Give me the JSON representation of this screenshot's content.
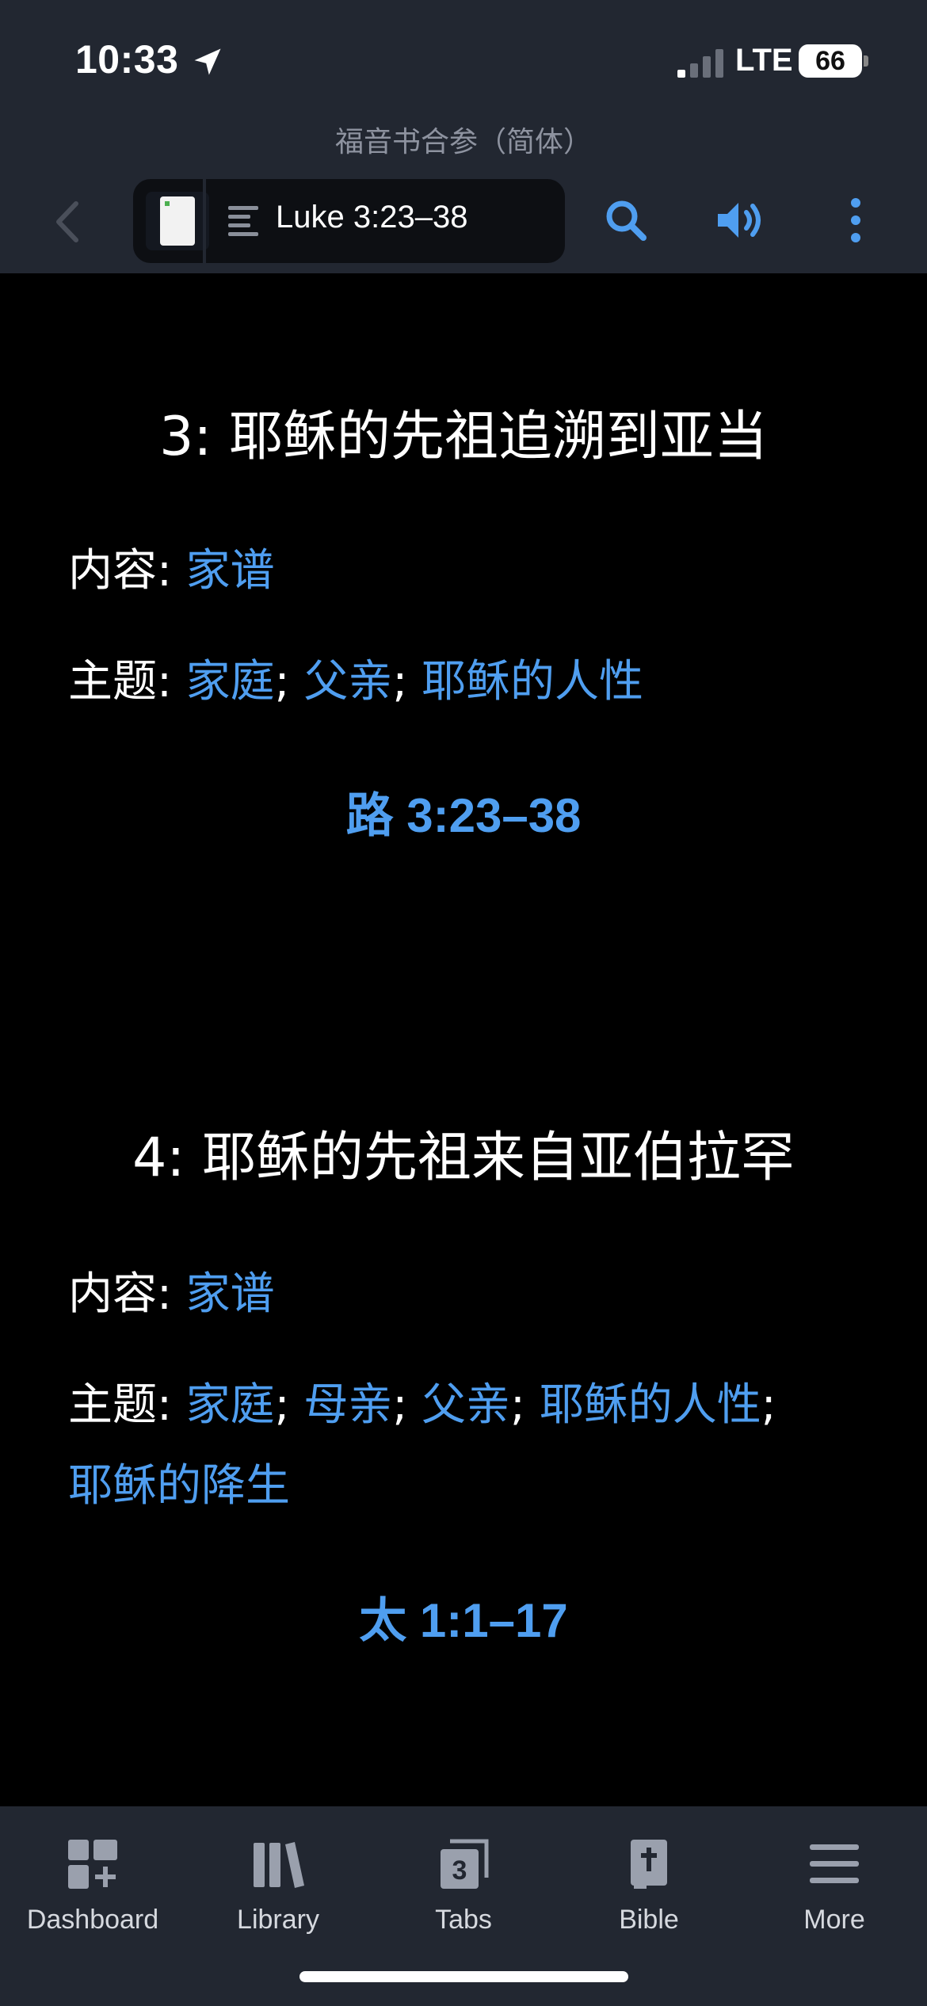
{
  "status_bar": {
    "time": "10:33",
    "network": "LTE",
    "battery": "66"
  },
  "header": {
    "subtitle": "福音书合参（简体）",
    "reference": "Luke 3:23–38"
  },
  "sections": [
    {
      "heading": "3: 耶稣的先祖追溯到亚当",
      "content_label": "内容: ",
      "content_link": "家谱",
      "topics_label": "主题: ",
      "topics": [
        "家庭",
        "父亲",
        "耶稣的人性"
      ],
      "passage": "路 3:23–38"
    },
    {
      "heading": "4: 耶稣的先祖来自亚伯拉罕",
      "content_label": "内容: ",
      "content_link": "家谱",
      "topics_label": "主题: ",
      "topics": [
        "家庭",
        "母亲",
        "父亲",
        "耶稣的人性",
        "耶稣的降生"
      ],
      "passage": "太 1:1–17"
    }
  ],
  "separator": "; ",
  "tabbar": {
    "items": [
      {
        "label": "Dashboard",
        "icon": "dashboard-icon"
      },
      {
        "label": "Library",
        "icon": "library-icon"
      },
      {
        "label": "Tabs",
        "icon": "tabs-icon",
        "badge": "3"
      },
      {
        "label": "Bible",
        "icon": "bible-icon"
      },
      {
        "label": "More",
        "icon": "menu-icon"
      }
    ]
  },
  "colors": {
    "bar_background": "#222731",
    "content_background": "#000000",
    "accent": "#4f9ef0",
    "tab_icon": "#9aa0ad"
  }
}
